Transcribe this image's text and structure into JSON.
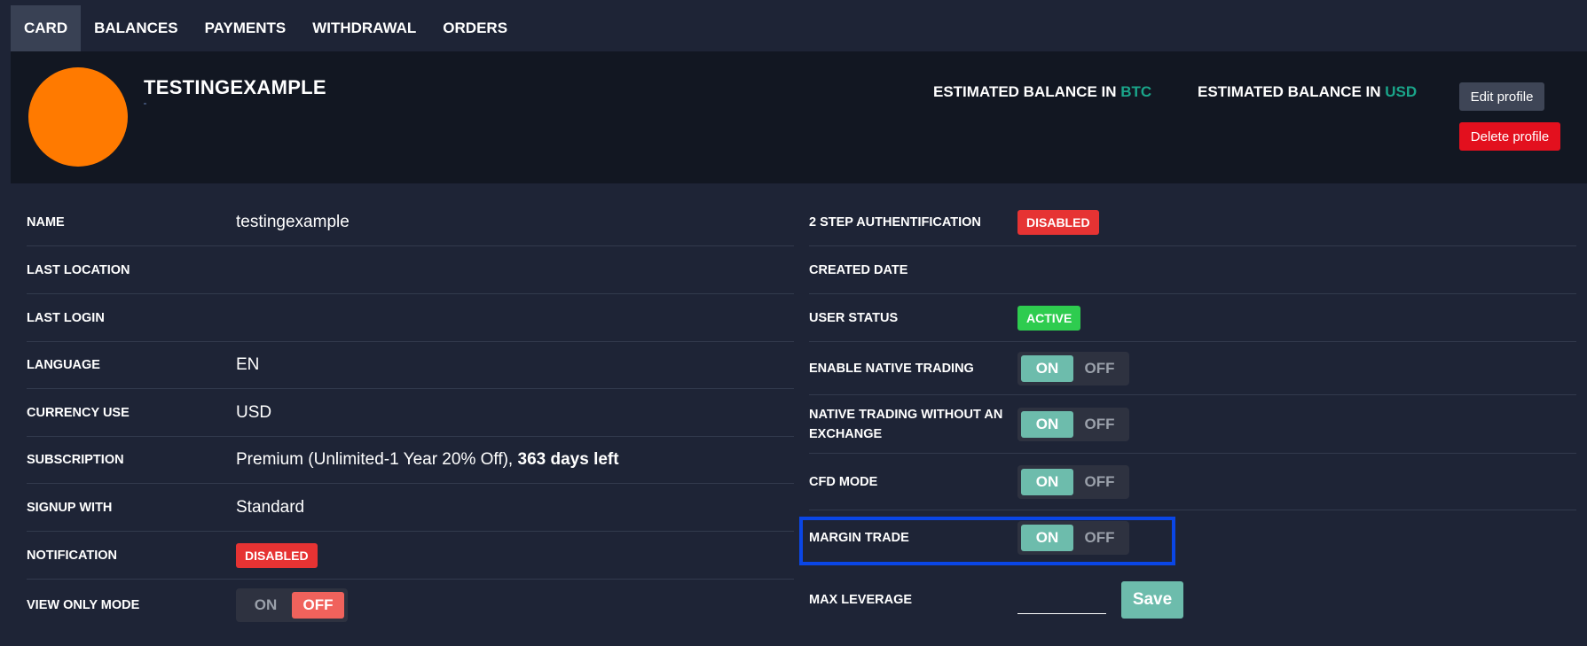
{
  "tabs": [
    {
      "label": "CARD",
      "active": true
    },
    {
      "label": "BALANCES"
    },
    {
      "label": "PAYMENTS"
    },
    {
      "label": "WITHDRAWAL"
    },
    {
      "label": "ORDERS"
    }
  ],
  "header": {
    "username": "TESTINGEXAMPLE",
    "avatar_color": "#ff7a00",
    "est_btc_prefix": "ESTIMATED BALANCE IN",
    "est_btc_currency": "BTC",
    "est_usd_prefix": "ESTIMATED BALANCE IN",
    "est_usd_currency": "USD",
    "edit_label": "Edit profile",
    "delete_label": "Delete profile"
  },
  "left": {
    "name_label": "NAME",
    "name_value": "testingexample",
    "last_location_label": "LAST LOCATION",
    "last_login_label": "LAST LOGIN",
    "language_label": "LANGUAGE",
    "language_value": "EN",
    "currency_label": "CURRENCY USE",
    "currency_value": "USD",
    "subscription_label": "SUBSCRIPTION",
    "subscription_value": "Premium (Unlimited-1 Year 20% Off),",
    "subscription_days": "363 days left",
    "signup_label": "SIGNUP WITH",
    "signup_value": "Standard",
    "notification_label": "NOTIFICATION",
    "notification_status": "DISABLED",
    "view_only_label": "VIEW ONLY MODE"
  },
  "right": {
    "two_step_label": "2 STEP AUTHENTIFICATION",
    "two_step_status": "DISABLED",
    "created_label": "CREATED DATE",
    "user_status_label": "USER STATUS",
    "user_status_value": "ACTIVE",
    "native_trading_label": "ENABLE NATIVE TRADING",
    "native_no_exchange_label_1": "NATIVE TRADING WITHOUT AN",
    "native_no_exchange_label_2": "EXCHANGE",
    "cfd_label": "CFD MODE",
    "margin_label": "MARGIN TRADE",
    "max_leverage_label": "MAX LEVERAGE",
    "save_label": "Save"
  },
  "toggle": {
    "on": "ON",
    "off": "OFF"
  },
  "colors": {
    "background": "#1e2436",
    "header_bg": "#121722",
    "accent_teal": "#6dbcac",
    "currency_green": "#1aa58a",
    "danger": "#e63333",
    "success": "#2ecc4f",
    "off_red": "#f0625c",
    "highlight": "#0a46e6"
  }
}
